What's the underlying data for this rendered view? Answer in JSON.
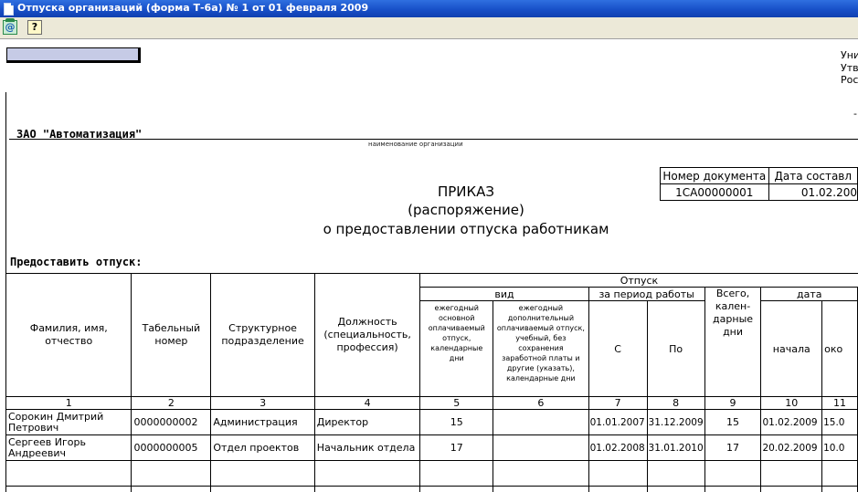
{
  "window": {
    "title": "Отпуска организаций (форма Т-6а) № 1 от 01 февраля 2009"
  },
  "toolbar": {
    "mail_icon": "mail-icon",
    "help_label": "?"
  },
  "form": {
    "corner_lines": [
      "Уни",
      "Утв",
      "Рос"
    ],
    "corner_mark": "-",
    "org_name": "ЗАО \"Автоматизация\"",
    "org_caption": "наименование организации",
    "doc_table": {
      "headers": [
        "Номер документа",
        "Дата составл"
      ],
      "values": [
        "1СА00000001",
        "01.02.200"
      ]
    },
    "title_lines": [
      "ПРИКАЗ",
      "(распоряжение)",
      "о предоставлении отпуска работникам"
    ],
    "grant_label": "Предоставить отпуск:"
  },
  "grid": {
    "headers": {
      "fio": "Фамилия, имя, отчество",
      "tab_no": "Табельный номер",
      "dept": "Структурное подразделение",
      "position": "Должность (специальность, профессия)",
      "vacation": "Отпуск",
      "kind": "вид",
      "period": "за период работы",
      "total": "Всего, кален-дарные дни",
      "date": "дата",
      "kind_main": "ежегодный основной оплачиваемый отпуск, календарные дни",
      "kind_extra": "ежегодный дополнительный оплачиваемый отпуск, учебный, без сохранения заработной платы и другие (указать), календарные дни",
      "period_from": "С",
      "period_to": "По",
      "date_start": "начала",
      "date_end": "око"
    },
    "column_numbers": [
      "1",
      "2",
      "3",
      "4",
      "5",
      "6",
      "7",
      "8",
      "9",
      "10",
      "11"
    ],
    "rows": [
      {
        "fio": "Сорокин Дмитрий Петрович",
        "tab_no": "0000000002",
        "dept": "Администрация",
        "position": "Директор",
        "main_days": "15",
        "extra_days": "",
        "from": "01.01.2007",
        "to": "31.12.2009",
        "total": "15",
        "start": "01.02.2009",
        "end": "15.0"
      },
      {
        "fio": "Сергеев Игорь Андреевич",
        "tab_no": "0000000005",
        "dept": "Отдел проектов",
        "position": "Начальник отдела",
        "main_days": "17",
        "extra_days": "",
        "from": "01.02.2008",
        "to": "31.01.2010",
        "total": "17",
        "start": "20.02.2009",
        "end": "10.0"
      }
    ]
  }
}
